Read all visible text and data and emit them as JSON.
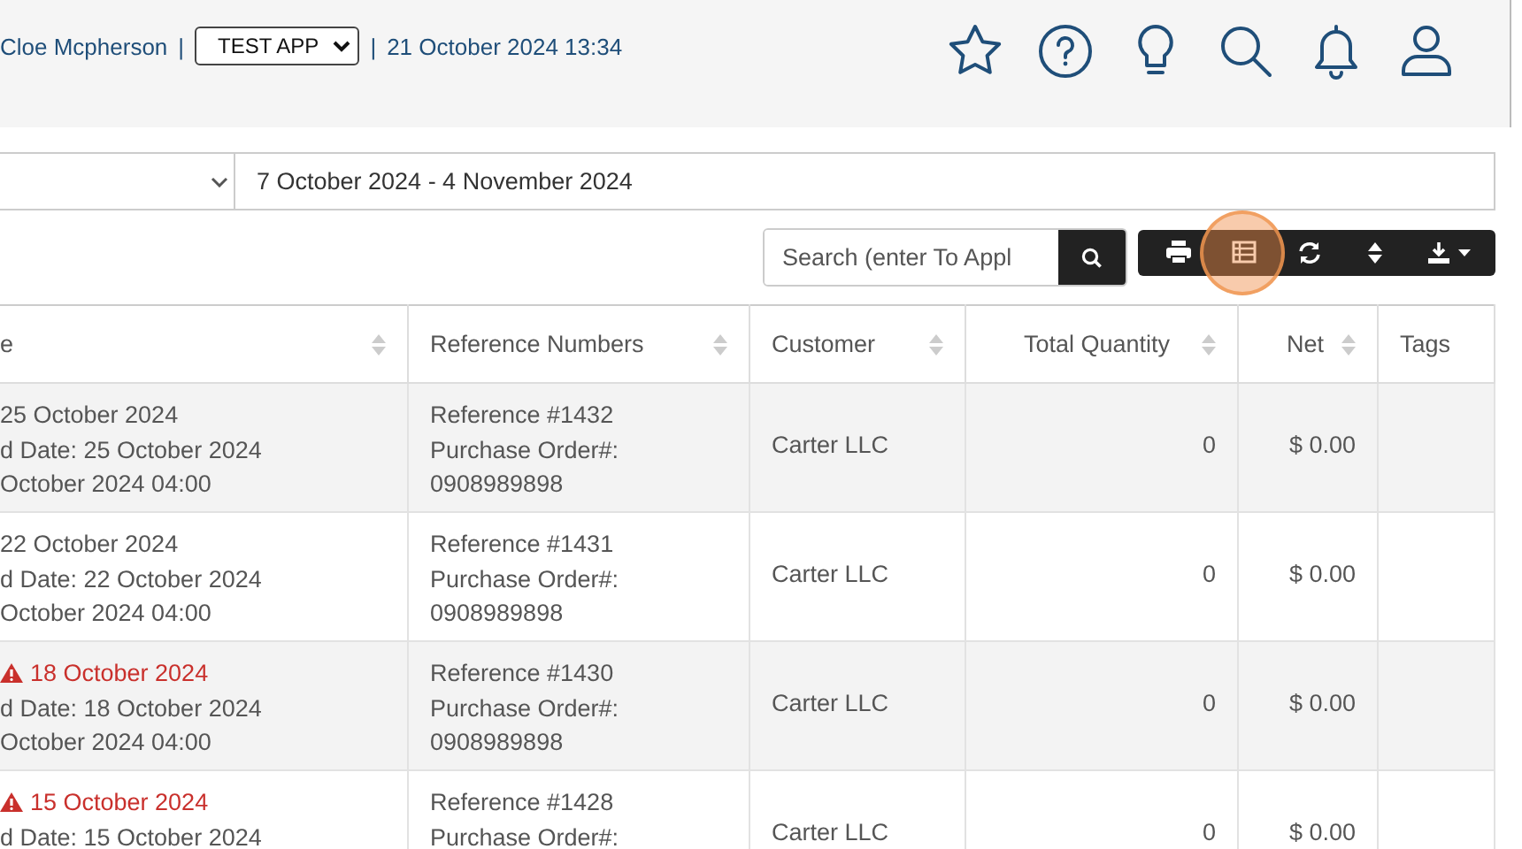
{
  "header": {
    "user": "Cloe Mcpherson",
    "separator_1": "|",
    "app_select": "TEST APP",
    "separator_2": "|",
    "datetime": "21 October 2024 13:34"
  },
  "filters": {
    "date_range": "7 October 2024 - 4 November 2024"
  },
  "search": {
    "placeholder": "Search (enter To Appl"
  },
  "table": {
    "columns": [
      {
        "label": "e",
        "sortable": true
      },
      {
        "label": "Reference Numbers",
        "sortable": true
      },
      {
        "label": "Customer",
        "sortable": true
      },
      {
        "label": "Total Quantity",
        "sortable": true
      },
      {
        "label": "Net",
        "sortable": true
      },
      {
        "label": "Tags",
        "sortable": false
      }
    ],
    "rows": [
      {
        "date": "25 October 2024",
        "overdue": false,
        "due_date": "d Date: 25 October 2024",
        "created": "October 2024 04:00",
        "reference": "Reference #1432",
        "po_label": "Purchase Order#:",
        "po_number": "0908989898",
        "customer": "Carter LLC",
        "quantity": "0",
        "net": "$ 0.00"
      },
      {
        "date": "22 October 2024",
        "overdue": false,
        "due_date": "d Date: 22 October 2024",
        "created": "October 2024 04:00",
        "reference": "Reference #1431",
        "po_label": "Purchase Order#:",
        "po_number": "0908989898",
        "customer": "Carter LLC",
        "quantity": "0",
        "net": "$ 0.00"
      },
      {
        "date": "18 October 2024",
        "overdue": true,
        "due_date": "d Date: 18 October 2024",
        "created": "October 2024 04:00",
        "reference": "Reference #1430",
        "po_label": "Purchase Order#:",
        "po_number": "0908989898",
        "customer": "Carter LLC",
        "quantity": "0",
        "net": "$ 0.00"
      },
      {
        "date": "15 October 2024",
        "overdue": true,
        "due_date": "d Date: 15 October 2024",
        "reference": "Reference #1428",
        "po_label": "Purchase Order#:",
        "customer": "Carter LLC",
        "quantity": "0",
        "net": "$ 0.00"
      }
    ]
  }
}
